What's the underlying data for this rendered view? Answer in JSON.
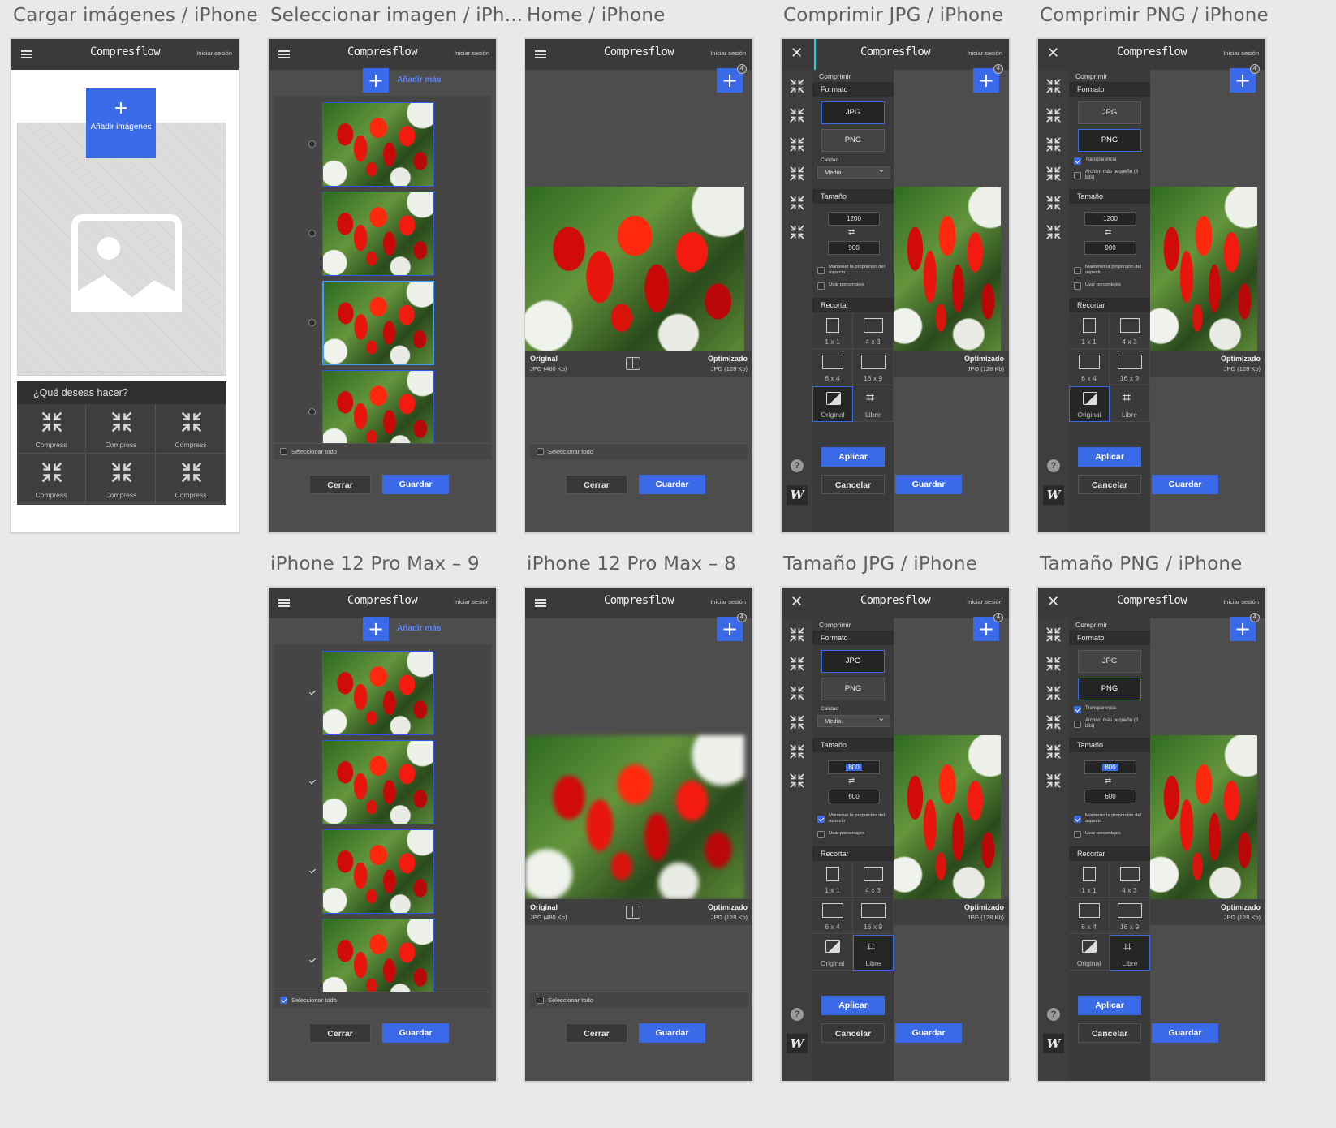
{
  "app": {
    "logo": "Compresflow",
    "login": "Iniciar sesión",
    "badge": "4",
    "plus": "+"
  },
  "boards": {
    "upload": "Cargar imágenes / iPhone",
    "select": "Seleccionar imagen / iPh...",
    "home": "Home / iPhone",
    "cjpg": "Comprimir JPG / iPhone",
    "cpng": "Comprimir PNG / iPhone",
    "p9": "iPhone 12 Pro Max – 9",
    "p8": "iPhone 12 Pro Max – 8",
    "tjpg": "Tamaño JPG / iPhone",
    "tpng": "Tamaño PNG / iPhone"
  },
  "upload": {
    "add_label": "Añadir imágenes",
    "question": "¿Qué deseas hacer?",
    "tiles": [
      "Compress",
      "Compress",
      "Compress",
      "Compress",
      "Compress",
      "Compress"
    ]
  },
  "list": {
    "add_more": "Añadir más",
    "select_all": "Seleccionar todo"
  },
  "compare": {
    "original": "Original",
    "original_info": "JPG (480 Kb)",
    "optimized": "Optimizado",
    "optimized_info": "JPG (128 Kb)"
  },
  "actions": {
    "close": "Cerrar",
    "save": "Guardar",
    "apply": "Aplicar",
    "cancel": "Cancelar"
  },
  "panel": {
    "title": "Comprimir",
    "format": "Formato",
    "jpg": "JPG",
    "png": "PNG",
    "quality": "Calidad",
    "quality_value": "Media",
    "transparency": "Transparencia",
    "small_file": "Archivo más pequeño (8 bits)",
    "size": "Tamaño",
    "width_a": "1200",
    "height_a": "900",
    "width_b": "800",
    "height_b": "600",
    "keep_ratio": "Mantener la proporción del aspecto",
    "use_percent": "Usar porcentajes",
    "crop": "Recortar",
    "crops": [
      "1 x 1",
      "4 x 3",
      "6 x 4",
      "16 x 9",
      "Original",
      "Libre"
    ],
    "help": "?",
    "brand": "W"
  },
  "colors": {
    "accent": "#3b6ae8",
    "header": "#3a3a3a",
    "canvas": "#e9e9e9"
  }
}
